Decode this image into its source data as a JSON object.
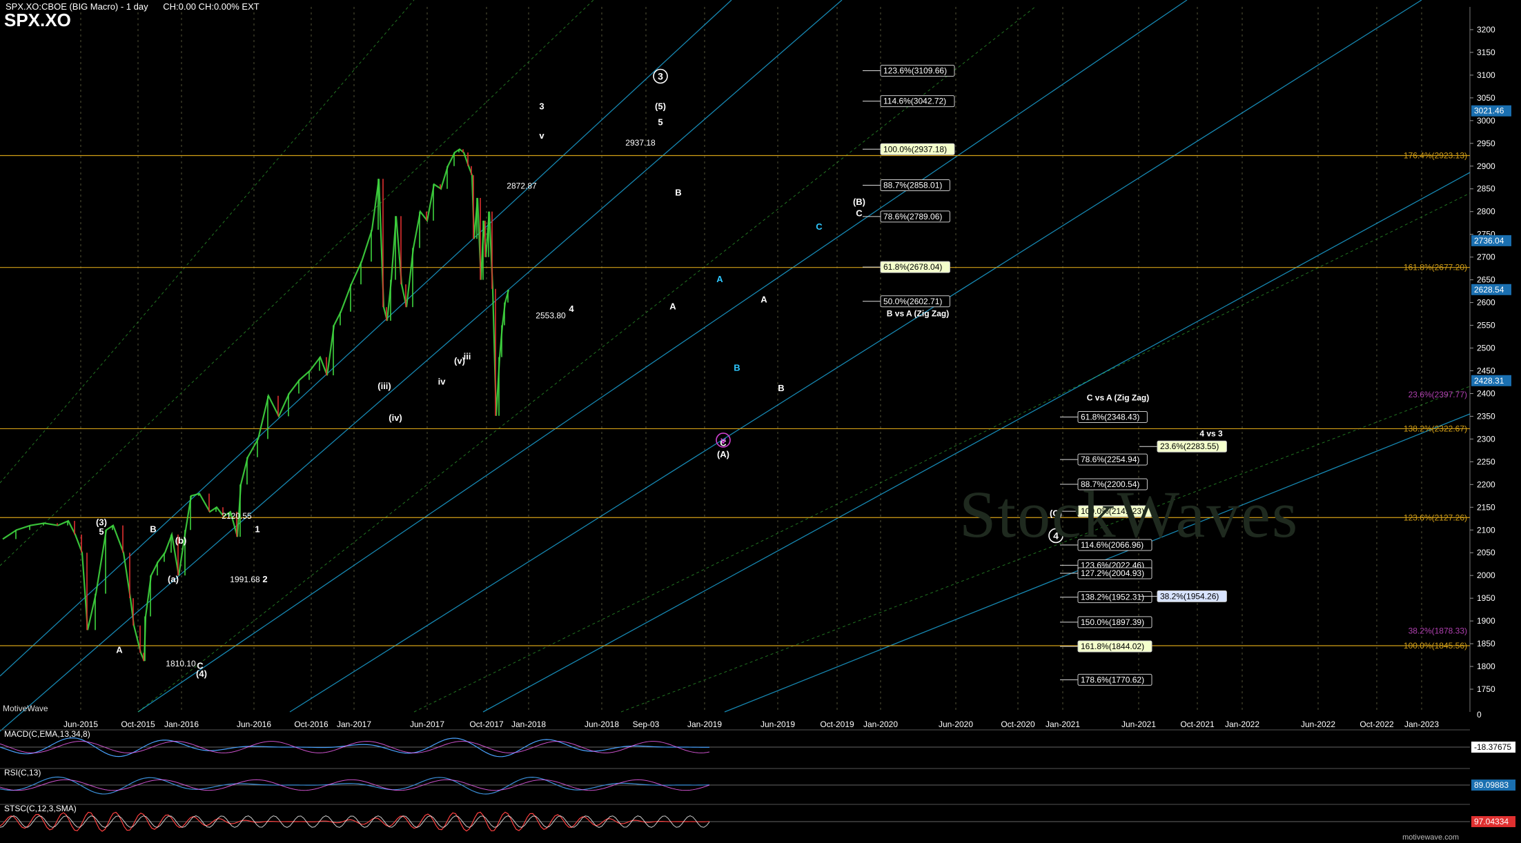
{
  "header": {
    "title": "SPX.XO:CBOE (BIG Macro) - 1 day",
    "change_info": "CH:0.00 CH:0.00% EXT",
    "symbol": "SPX.XO"
  },
  "footer": {
    "left": "MotiveWave",
    "right": "motivewave.com"
  },
  "watermark": "StockWaves",
  "colors": {
    "background": "#000000",
    "grid": "#8a8a60",
    "fib_line": "#d4a017",
    "channel": "#1b9fd0",
    "bull": "#3fd63f",
    "bear": "#e03030",
    "price_line": "#ffffff",
    "macd": "#4aa3ff",
    "signal": "#ff66ff",
    "rsi": "#3b8fd9",
    "stoch": "#ff4040",
    "wave_white": "#ffffff",
    "wave_cyan": "#2ec8ff",
    "wave_magenta": "#d040d0"
  },
  "chart_data": {
    "type": "line",
    "ylim": [
      1700,
      3250
    ],
    "price_axis_ticks": [
      1750,
      1800,
      1850,
      1900,
      1950,
      2000,
      2050,
      2100,
      2150,
      2200,
      2250,
      2300,
      2350,
      2400,
      2450,
      2500,
      2550,
      2600,
      2650,
      2700,
      2750,
      2800,
      2850,
      2900,
      2950,
      3000,
      3050,
      3100,
      3150,
      3200
    ],
    "x_labels": [
      "Jun-2015",
      "Oct-2015",
      "Jan-2016",
      "Jun-2016",
      "Oct-2016",
      "Jan-2017",
      "Jun-2017",
      "Oct-2017",
      "Jan-2018",
      "Jun-2018",
      "Sep-03",
      "Jan-2019",
      "Jun-2019",
      "Oct-2019",
      "Jan-2020",
      "Jun-2020",
      "Oct-2020",
      "Jan-2021",
      "Jun-2021",
      "Oct-2021",
      "Jan-2022",
      "Jun-2022",
      "Oct-2022",
      "Jan-2023"
    ],
    "series": [
      {
        "values_x": [
          0,
          20,
          40,
          60,
          80,
          95,
          105,
          115,
          123,
          135,
          150,
          160,
          175,
          185,
          190,
          200,
          205,
          207,
          215,
          225,
          235,
          245,
          255,
          265,
          273,
          285,
          300,
          310,
          320,
          330,
          340,
          345,
          355,
          370,
          385,
          400,
          415,
          430,
          445,
          460,
          470,
          480,
          490,
          505,
          520,
          535,
          545,
          552,
          557,
          563,
          570,
          578,
          585,
          595,
          605,
          615,
          625,
          635,
          645,
          655,
          662,
          668,
          675,
          680,
          683,
          688,
          693,
          697,
          700,
          705,
          710,
          715,
          720,
          724,
          728,
          733
        ],
        "values": [
          2080,
          2100,
          2110,
          2115,
          2110,
          2120,
          2090,
          2050,
          1880,
          1960,
          2100,
          2110,
          2050,
          1950,
          1890,
          1830,
          1812,
          1910,
          2000,
          2030,
          2050,
          2090,
          2000,
          2100,
          2175,
          2180,
          2140,
          2150,
          2130,
          2140,
          2085,
          2200,
          2260,
          2300,
          2395,
          2350,
          2400,
          2430,
          2450,
          2480,
          2440,
          2550,
          2580,
          2640,
          2690,
          2760,
          2872,
          2590,
          2560,
          2650,
          2790,
          2640,
          2590,
          2720,
          2800,
          2780,
          2860,
          2850,
          2900,
          2930,
          2937,
          2930,
          2900,
          2880,
          2740,
          2830,
          2650,
          2780,
          2700,
          2800,
          2630,
          2351,
          2480,
          2550,
          2600,
          2628
        ]
      },
      {
        "name": "MACD(C,EMA,13,34,8)",
        "last": "-18.37675"
      },
      {
        "name": "RSI(C,13)",
        "last": "89.09883"
      },
      {
        "name": "STSC(C,12,3,SMA)",
        "last": "97.04334"
      }
    ],
    "price_markers": [
      {
        "value": 3021.46,
        "label": "3021.46"
      },
      {
        "value": 2736.04,
        "label": "2736.04"
      },
      {
        "value": 2628.54,
        "label": "2628.54"
      },
      {
        "value": 2428.31,
        "label": "2428.31"
      }
    ],
    "fib_levels_right": [
      {
        "value": 2923.13,
        "label": "176.4%(2923.13)"
      },
      {
        "value": 2677.2,
        "label": "161.8%(2677.20)"
      },
      {
        "value": 2397.77,
        "label": "23.6%(2397.77)",
        "color": "#b040b0"
      },
      {
        "value": 2322.67,
        "label": "138.2%(2322.67)"
      },
      {
        "value": 2127.26,
        "label": "123.6%(2127.26)"
      },
      {
        "value": 1878.33,
        "label": "38.2%(1878.33)",
        "color": "#b040b0"
      },
      {
        "value": 1845.56,
        "label": "100.0%(1845.56)"
      }
    ],
    "fib_boxes_upper": [
      {
        "value": 3109.66,
        "label": "123.6%(3109.66)"
      },
      {
        "value": 3042.72,
        "label": "114.6%(3042.72)"
      },
      {
        "value": 2937.18,
        "label": "100.0%(2937.18)",
        "highlight": true
      },
      {
        "value": 2858.01,
        "label": "88.7%(2858.01)"
      },
      {
        "value": 2789.06,
        "label": "78.6%(2789.06)"
      },
      {
        "value": 2678.04,
        "label": "61.8%(2678.04)",
        "highlight": true
      },
      {
        "value": 2602.71,
        "label": "50.0%(2602.71)"
      }
    ],
    "fib_boxes_lower": [
      {
        "value": 2348.43,
        "label": "61.8%(2348.43)"
      },
      {
        "value": 2254.94,
        "label": "78.6%(2254.94)"
      },
      {
        "value": 2200.54,
        "label": "88.7%(2200.54)"
      },
      {
        "value": 2141.23,
        "label": "100.0%(2141.23)",
        "highlight": true
      },
      {
        "value": 2066.96,
        "label": "114.6%(2066.96)"
      },
      {
        "value": 2022.46,
        "label": "123.6%(2022.46)"
      },
      {
        "value": 2004.93,
        "label": "127.2%(2004.93)"
      },
      {
        "value": 1952.31,
        "label": "138.2%(1952.31)"
      },
      {
        "value": 1897.39,
        "label": "150.0%(1897.39)"
      },
      {
        "value": 1844.02,
        "label": "161.8%(1844.02)",
        "highlight": true
      },
      {
        "value": 1770.62,
        "label": "178.6%(1770.62)"
      }
    ],
    "fib_boxes_extra": [
      {
        "value": 2283.55,
        "label": "23.6%(2283.55)",
        "highlight": true
      },
      {
        "value": 1954.26,
        "label": "38.2%(1954.26)",
        "blue": true
      }
    ],
    "annotations": [
      {
        "text": "B vs A (Zig Zag)"
      },
      {
        "text": "C vs A (Zig Zag)"
      },
      {
        "text": "4 vs 3"
      }
    ],
    "price_labels": [
      {
        "text": "2937.18"
      },
      {
        "text": "2872.87"
      },
      {
        "text": "2553.80"
      },
      {
        "text": "2120.55"
      },
      {
        "text": "1991.68"
      },
      {
        "text": "1810.10"
      }
    ],
    "wave_labels": [
      {
        "text": "3",
        "circle": true,
        "color": "white"
      },
      {
        "text": "(5)",
        "color": "white"
      },
      {
        "text": "5",
        "color": "white"
      },
      {
        "text": "3",
        "color": "white"
      },
      {
        "text": "v",
        "color": "white"
      },
      {
        "text": "B",
        "color": "white"
      },
      {
        "text": "A",
        "color": "white"
      },
      {
        "text": "(B)",
        "color": "white"
      },
      {
        "text": "C",
        "color": "white"
      },
      {
        "text": "C",
        "color": "cyan"
      },
      {
        "text": "A",
        "color": "cyan"
      },
      {
        "text": "A",
        "color": "white"
      },
      {
        "text": "B",
        "color": "cyan"
      },
      {
        "text": "B",
        "color": "white"
      },
      {
        "text": "C",
        "color": "white"
      },
      {
        "text": "(A)",
        "color": "white"
      },
      {
        "text": "v",
        "circle": true,
        "color": "magenta"
      },
      {
        "text": "(C)",
        "color": "white"
      },
      {
        "text": "4",
        "circle": true,
        "color": "white"
      },
      {
        "text": "(3)",
        "color": "white"
      },
      {
        "text": "5",
        "color": "white"
      },
      {
        "text": "B",
        "color": "white"
      },
      {
        "text": "A",
        "color": "white"
      },
      {
        "text": "1",
        "color": "white"
      },
      {
        "text": "2",
        "color": "white"
      },
      {
        "text": "(4)",
        "color": "white"
      },
      {
        "text": "C",
        "color": "white"
      },
      {
        "text": "4",
        "color": "white"
      },
      {
        "text": "iii",
        "color": "white"
      },
      {
        "text": "(iii)",
        "color": "white"
      },
      {
        "text": "(iv)",
        "color": "white"
      },
      {
        "text": "iv",
        "color": "white"
      },
      {
        "text": "(v)",
        "color": "white"
      },
      {
        "text": "(a)",
        "color": "white"
      },
      {
        "text": "(b)",
        "color": "white"
      }
    ]
  }
}
